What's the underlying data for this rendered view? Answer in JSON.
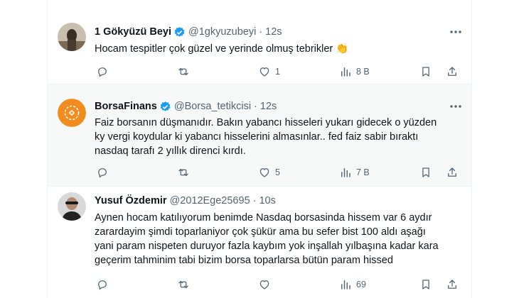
{
  "tweets": [
    {
      "name": "1 Gökyüzü Beyi",
      "handle": "@1gkyuzubeyi",
      "time": "12s",
      "lines": [
        "Hocam tespitler çok güzel ve yerinde olmuş tebrikler 👏"
      ],
      "stats": {
        "replies": "",
        "retweets": "",
        "likes": "1",
        "views": "8 B"
      }
    },
    {
      "name": "BorsaFinans",
      "handle": "@Borsa_tetikcisi",
      "time": "12s",
      "lines": [
        "Faiz borsanın düşmanıdır. Bakın yabancı hisseleri yukarı gidecek o yüzden",
        "ky vergi koydular ki yabancı hisselerini almasınlar.. fed faiz sabir bıraktı",
        "nasdaq tarafı 2 yıllık direnci kırdı."
      ],
      "stats": {
        "replies": "",
        "retweets": "",
        "likes": "5",
        "views": "7 B"
      }
    },
    {
      "name": "Yusuf Özdemir",
      "handle": "@2012Ege25695",
      "time": "10s",
      "lines": [
        "Aynen hocam katılıyorum benimde Nasdaq borsasinda hissem var 6 aydır",
        "zarardayim şimdi toparlaniyor çok şükür ama bu sefer bist 100 aldı aşağı",
        "yani param nispeten duruyor fazla kaybım yok inşallah yılbaşına kadar kara",
        "geçerim tahminim tabi bizim borsa toparlarsa bütün param hissed"
      ],
      "stats": {
        "replies": "",
        "retweets": "",
        "likes": "",
        "views": "69"
      }
    }
  ],
  "colors": {
    "verified": "#1d9bf0",
    "muted": "#536471",
    "highlight_bg": "#f7f9f9",
    "finans_brand": "#f28c1e"
  },
  "icons": [
    "verified-badge-icon",
    "more-icon",
    "reply-icon",
    "retweet-icon",
    "like-icon",
    "views-icon",
    "bookmark-icon",
    "share-icon"
  ]
}
